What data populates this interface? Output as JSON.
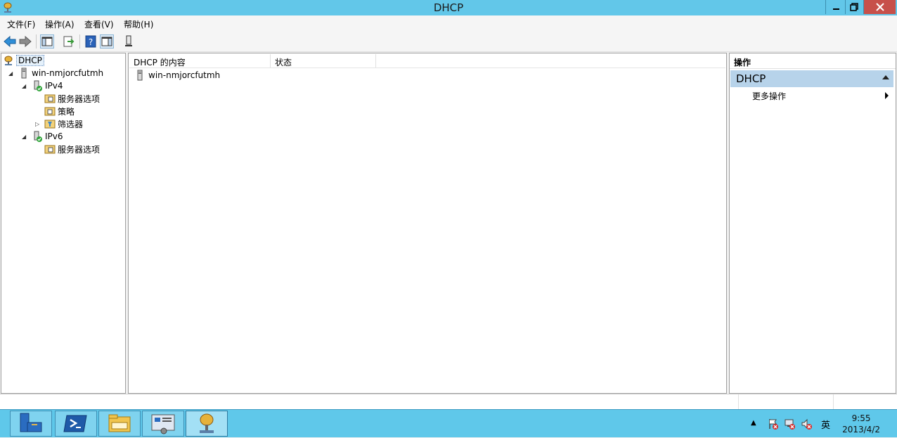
{
  "window": {
    "title": "DHCP"
  },
  "menu": [
    {
      "label": "文件(F)"
    },
    {
      "label": "操作(A)"
    },
    {
      "label": "查看(V)"
    },
    {
      "label": "帮助(H)"
    }
  ],
  "toolbar": {
    "icons": [
      "back-arrow-icon",
      "forward-arrow-icon",
      "show-hide-console-tree-icon",
      "export-list-icon",
      "help-icon",
      "show-hide-action-pane-icon",
      "server-icon"
    ]
  },
  "tree": {
    "root": "DHCP",
    "server": "win-nmjorcfutmh",
    "ipv4": "IPv4",
    "ipv4_server_options": "服务器选项",
    "ipv4_policies": "策略",
    "ipv4_filters": "筛选器",
    "ipv6": "IPv6",
    "ipv6_server_options": "服务器选项"
  },
  "content": {
    "columns": [
      "DHCP 的内容",
      "状态"
    ],
    "rows": [
      {
        "name": "win-nmjorcfutmh",
        "status": ""
      }
    ]
  },
  "actions": {
    "header": "操作",
    "section": "DHCP",
    "items": [
      {
        "label": "更多操作"
      }
    ]
  },
  "taskbar": {
    "clock_time": "9:55",
    "clock_date": "2013/4/2",
    "ime": "英"
  },
  "colors": {
    "titlebar": "#62c7e9",
    "taskbar": "#5fc8ea",
    "close_button": "#c7504a",
    "action_section": "#b7d3ea"
  }
}
